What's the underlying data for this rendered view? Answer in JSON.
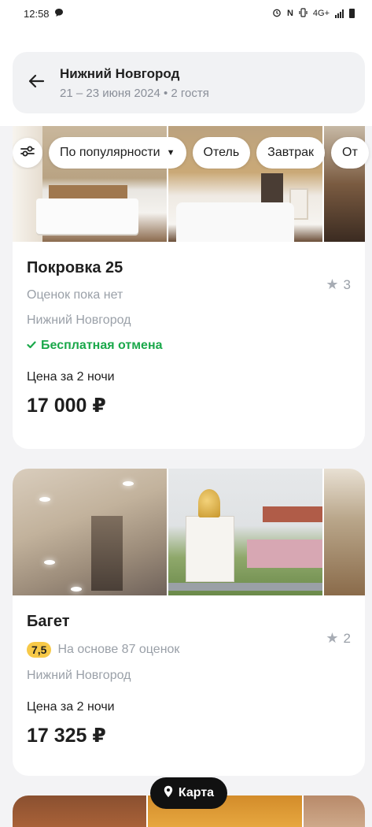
{
  "status_bar": {
    "time": "12:58",
    "network": "4G+"
  },
  "header": {
    "title": "Нижний Новгород",
    "subtitle": "21 – 23 июня 2024 • 2 гостя"
  },
  "filters": {
    "sort_label": "По популярности",
    "chips": [
      "Отель",
      "Завтрак",
      "От"
    ]
  },
  "listings": [
    {
      "name": "Покровка 25",
      "stars": "3",
      "rating_text": "Оценок пока нет",
      "city": "Нижний Новгород",
      "free_cancellation": "Бесплатная отмена",
      "price_label": "Цена за 2 ночи",
      "price": "17 000 ₽"
    },
    {
      "name": "Багет",
      "stars": "2",
      "rating_score": "7,5",
      "rating_text": "На основе 87 оценок",
      "city": "Нижний Новгород",
      "price_label": "Цена за 2 ночи",
      "price": "17 325 ₽"
    }
  ],
  "map_button": {
    "label": "Карта"
  },
  "colors": {
    "accent_green": "#1aa84a",
    "rating_yellow": "#f7c948",
    "map_button_bg": "#111111"
  }
}
